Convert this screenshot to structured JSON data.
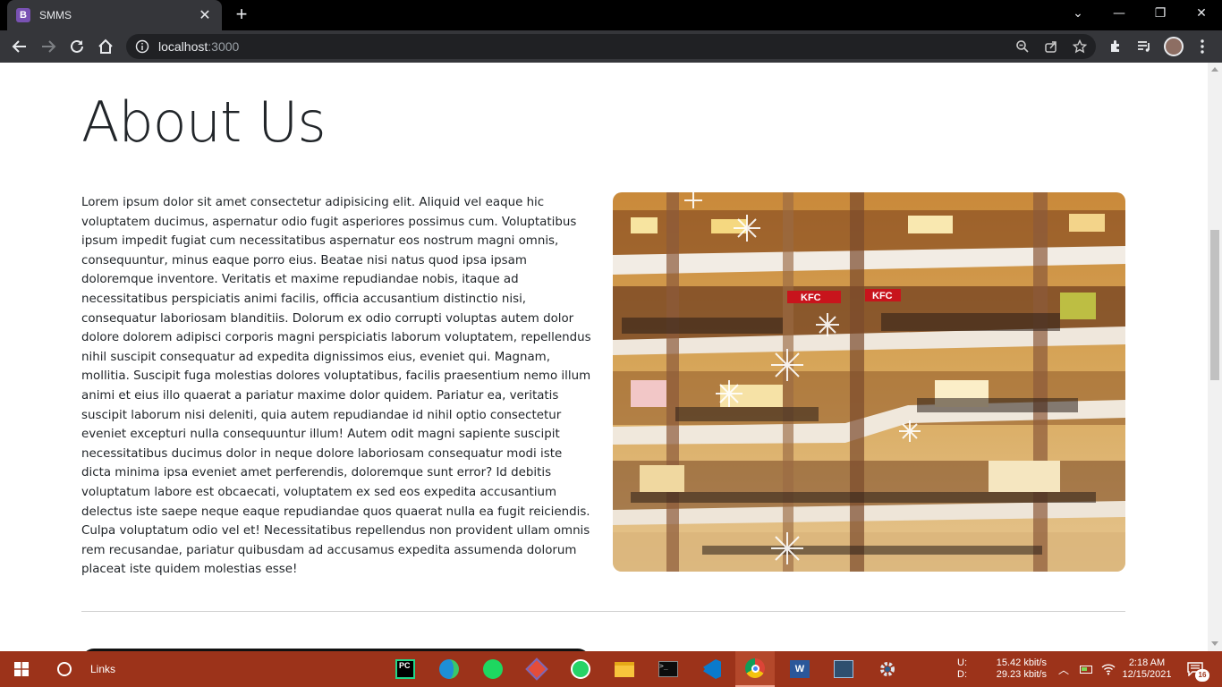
{
  "browser": {
    "tab_title": "SMMS",
    "tab_favicon_letter": "B",
    "new_tab_label": "+",
    "url_host": "localhost",
    "url_port": ":3000"
  },
  "page": {
    "heading": "About Us",
    "paragraph": "Lorem ipsum dolor sit amet consectetur adipisicing elit. Aliquid vel eaque hic voluptatem ducimus, aspernatur odio fugit asperiores possimus cum. Voluptatibus ipsum impedit fugiat cum necessitatibus aspernatur eos nostrum magni omnis, consequuntur, minus eaque porro eius. Beatae nisi natus quod ipsa ipsam doloremque inventore. Veritatis et maxime repudiandae nobis, itaque ad necessitatibus perspiciatis animi facilis, officia accusantium distinctio nisi, consequatur laboriosam blanditiis. Dolorum ex odio corrupti voluptas autem dolor dolore dolorem adipisci corporis magni perspiciatis laborum voluptatem, repellendus nihil suscipit consequatur ad expedita dignissimos eius, eveniet qui. Magnam, mollitia. Suscipit fuga molestias dolores voluptatibus, facilis praesentium nemo illum animi et eius illo quaerat a pariatur maxime dolor quidem. Pariatur ea, veritatis suscipit laborum nisi deleniti, quia autem repudiandae id nihil optio consectetur eveniet excepturi nulla consequuntur illum! Autem odit magni sapiente suscipit necessitatibus ducimus dolor in neque dolore laboriosam consequatur modi iste dicta minima ipsa eveniet amet perferendis, doloremque sunt error? Id debitis voluptatum labore est obcaecati, voluptatem ex sed eos expedita accusantium delectus iste saepe neque eaque repudiandae quos quaerat nulla ea fugit reiciendis. Culpa voluptatum odio vel et! Necessitatibus repellendus non provident ullam omnis rem recusandae, pariatur quibusdam ad accusamus expedita assumenda dolorum placeat iste quidem molestias esse!",
    "photo_alt": "shopping-mall-photo",
    "photo_signs": [
      "KFC",
      "KFC"
    ]
  },
  "taskbar": {
    "search_label": "Links",
    "net_up_label": "U:",
    "net_down_label": "D:",
    "net_up_value": "15.42 kbit/s",
    "net_down_value": "29.23 kbit/s",
    "time": "2:18 AM",
    "date": "12/15/2021",
    "notification_count": "16",
    "apps": [
      "pycharm-icon",
      "edge-icon",
      "spotify-icon",
      "git-icon",
      "whatsapp-icon",
      "file-explorer-icon",
      "terminal-icon",
      "vscode-icon",
      "chrome-icon",
      "word-icon",
      "mysql-workbench-icon",
      "settings-icon"
    ]
  },
  "colors": {
    "taskbar": "#9c331a",
    "chrome_dark": "#35363a",
    "text": "#212529"
  }
}
